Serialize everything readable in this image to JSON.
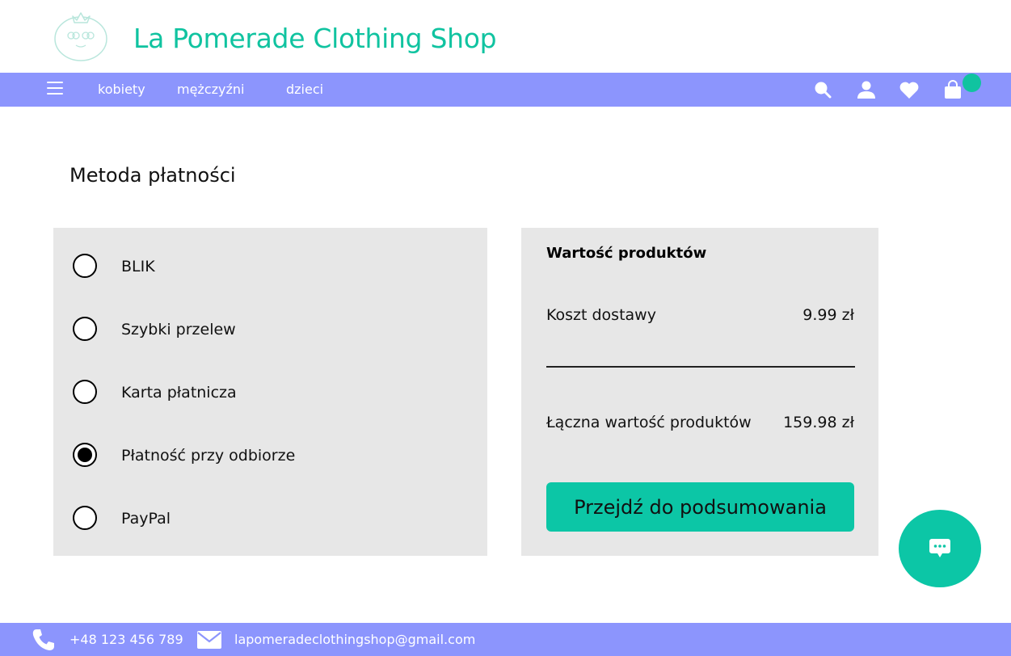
{
  "header": {
    "shop_name": "La Pomerade Clothing Shop"
  },
  "nav": {
    "links": [
      "kobiety",
      "mężczyźni",
      "dzieci"
    ],
    "icons": [
      "menu-icon",
      "search-icon",
      "user-icon",
      "heart-icon",
      "cart-icon"
    ]
  },
  "payment": {
    "title": "Metoda płatności",
    "options": [
      {
        "label": "BLIK",
        "selected": false
      },
      {
        "label": "Szybki przelew",
        "selected": false
      },
      {
        "label": "Karta płatnicza",
        "selected": false
      },
      {
        "label": "Płatność przy odbiorze",
        "selected": true
      },
      {
        "label": "PayPal",
        "selected": false
      }
    ]
  },
  "summary": {
    "heading": "Wartość produktów",
    "shipping_label": "Koszt dostawy",
    "shipping_value": "9.99 zł",
    "total_label": "Łączna wartość produktów",
    "total_value": "159.98 zł",
    "cta_label": "Przejdź do podsumowania"
  },
  "footer": {
    "phone": "+48 123 456 789",
    "email": "lapomeradeclothingshop@gmail.com"
  },
  "colors": {
    "accent": "#10c3a0",
    "nav_bg": "#8c95fd",
    "panel_bg": "#e7e7e7"
  }
}
